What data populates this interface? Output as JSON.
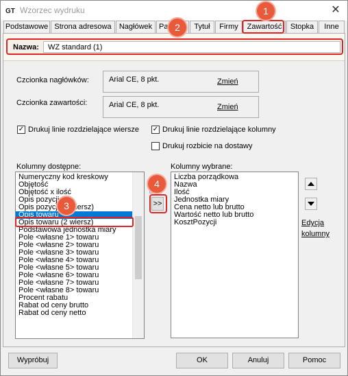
{
  "window": {
    "title": "Wzorzec wydruku",
    "close_glyph": "✕"
  },
  "tabs": [
    {
      "label": "Podstawowe"
    },
    {
      "label": "Strona adresowa"
    },
    {
      "label": "Nagłówek"
    },
    {
      "label": "Pa"
    },
    {
      "label": "Tytuł"
    },
    {
      "label": "Firmy"
    },
    {
      "label": "Zawartość"
    },
    {
      "label": "Stopka"
    },
    {
      "label": "Inne"
    }
  ],
  "name": {
    "label": "Nazwa:",
    "value": "WZ standard (1)"
  },
  "fonts": {
    "header_label": "Czcionka nagłówków:",
    "header_value": "Arial CE, 8 pkt.",
    "content_label": "Czcionka zawartości:",
    "content_value": "Arial CE, 8 pkt.",
    "change_label": "Zmień"
  },
  "options": {
    "row_lines": {
      "label": "Drukuj linie rozdzielające wiersze",
      "checked": true
    },
    "col_lines": {
      "label": "Drukuj linie rozdzielające kolumny",
      "checked": true
    },
    "delivery_split": {
      "label": "Drukuj rozbicie na dostawy",
      "checked": false
    }
  },
  "available": {
    "label": "Kolumny dostępne:",
    "items": [
      "Numeryczny kod kreskowy",
      "Objętość",
      "Objętość x ilość",
      "Opis pozycji",
      "Opis pozycji (2 wiersz)",
      "Opis towaru",
      "Opis towaru (2 wiersz)",
      "Podstawowa jednostka miary",
      "Pole <własne 1> towaru",
      "Pole <własne 2> towaru",
      "Pole <własne 3> towaru",
      "Pole <własne 4> towaru",
      "Pole <własne 5> towaru",
      "Pole <własne 6> towaru",
      "Pole <własne 7> towaru",
      "Pole <własne 8> towaru",
      "Procent rabatu",
      "Rabat od ceny brutto",
      "Rabat od ceny netto"
    ],
    "selected": "Opis towaru"
  },
  "selected_cols": {
    "label": "Kolumny wybrane:",
    "items": [
      "Liczba porządkowa",
      "Nazwa",
      "Ilość",
      "Jednostka miary",
      "Cena netto lub brutto",
      "Wartość netto lub brutto",
      "KosztPozycji"
    ]
  },
  "move": {
    "add": ">>"
  },
  "edit_columns": {
    "line1": "Edycja",
    "line2": "kolumny"
  },
  "footer": {
    "preview": "Wypróbuj",
    "ok": "OK",
    "cancel": "Anuluj",
    "help": "Pomoc"
  },
  "annotations": {
    "b1": "1",
    "b2": "2",
    "b3": "3",
    "b4": "4",
    "color": "#e85a3a"
  }
}
